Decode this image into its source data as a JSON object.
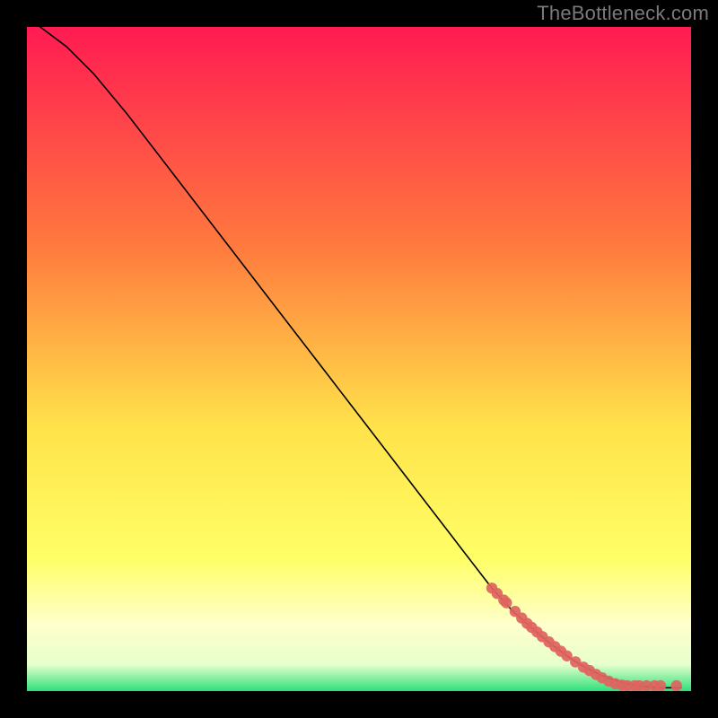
{
  "watermark": "TheBottleneck.com",
  "chart_data": {
    "type": "line",
    "title": "",
    "xlabel": "",
    "ylabel": "",
    "xlim": [
      0,
      100
    ],
    "ylim": [
      0,
      100
    ],
    "background_gradient": [
      {
        "stop": 0.0,
        "color": "#ff1b52"
      },
      {
        "stop": 0.33,
        "color": "#ff7a3e"
      },
      {
        "stop": 0.6,
        "color": "#ffe24a"
      },
      {
        "stop": 0.8,
        "color": "#ffff66"
      },
      {
        "stop": 0.9,
        "color": "#ffffcc"
      },
      {
        "stop": 0.96,
        "color": "#e6ffcc"
      },
      {
        "stop": 1.0,
        "color": "#2ee07a"
      }
    ],
    "series": [
      {
        "name": "curve",
        "style": "line",
        "color": "#000000",
        "x": [
          2,
          6,
          10,
          15,
          20,
          25,
          30,
          35,
          40,
          45,
          50,
          55,
          60,
          65,
          70,
          73,
          76,
          79,
          82,
          84,
          86,
          88,
          90,
          92,
          94,
          95.5,
          97,
          98.5
        ],
        "y": [
          100,
          97,
          93,
          87,
          80.5,
          74,
          67.5,
          61,
          54.5,
          48,
          41.5,
          35,
          28.5,
          22,
          15.5,
          12.2,
          9.5,
          7.0,
          4.8,
          3.6,
          2.6,
          1.8,
          1.2,
          0.8,
          0.6,
          0.5,
          0.5,
          0.5
        ]
      },
      {
        "name": "markers",
        "style": "points",
        "color": "#e0635e",
        "x": [
          70.0,
          70.8,
          71.8,
          72.2,
          73.5,
          74.5,
          75.3,
          76.0,
          76.8,
          77.6,
          78.6,
          79.5,
          80.4,
          81.3,
          82.6,
          83.8,
          84.7,
          85.7,
          86.6,
          87.6,
          88.6,
          89.6,
          90.4,
          91.5,
          92.2,
          93.3,
          94.5,
          95.4,
          97.8
        ],
        "y": [
          15.5,
          14.7,
          13.7,
          13.3,
          12.0,
          11.0,
          10.2,
          9.6,
          8.9,
          8.2,
          7.4,
          6.7,
          6.0,
          5.3,
          4.4,
          3.6,
          3.1,
          2.5,
          2.0,
          1.5,
          1.1,
          0.9,
          0.8,
          0.8,
          0.8,
          0.8,
          0.8,
          0.8,
          0.8
        ]
      }
    ]
  }
}
